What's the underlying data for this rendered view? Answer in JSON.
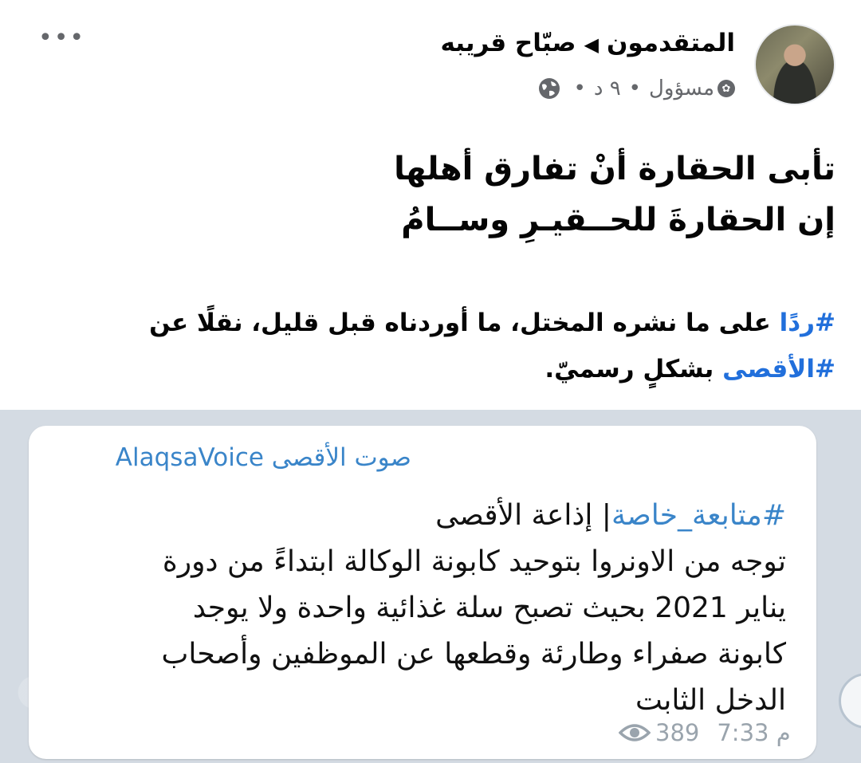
{
  "post": {
    "group_name": "المتقدمون",
    "author_name": "صبّاح قريبه",
    "role": "مسؤول",
    "time": "٩ د",
    "dot": "•",
    "more": "•••"
  },
  "poem": {
    "line1": "تأبى الحقارة أنْ تفارق أهلها",
    "line2": "إن الحقارةَ للحــقيـرِ وســامُ"
  },
  "body": {
    "hashtag1": "#ردًا",
    "text1": " على ما نشره المختل، ما أوردناه قبل قليل، نقلًا عن ",
    "hashtag2": "#الأقصى",
    "text2": " بشكلٍ رسميّ."
  },
  "attachment": {
    "channel": "صوت الأقصى AlaqsaVoice",
    "tag": "#متابعة_خاصة",
    "tag_rest": "| إذاعة الأقصى",
    "line1": "توجه من الاونروا بتوحيد كابونة الوكالة ابتداءً  من دورة",
    "line2": "يناير 2021 بحيث تصبح سلة غذائية واحدة ولا يوجد",
    "line3": "كابونة صفراء وطارئة وقطعها عن الموظفين وأصحاب",
    "line4": "الدخل الثابت",
    "time": "7:33 م",
    "views": "389"
  },
  "icons": {
    "globe": "globe-icon",
    "badge": "admin-badge-icon",
    "eye": "eye-icon",
    "arrow": "right-arrow-icon",
    "more": "more-icon"
  }
}
